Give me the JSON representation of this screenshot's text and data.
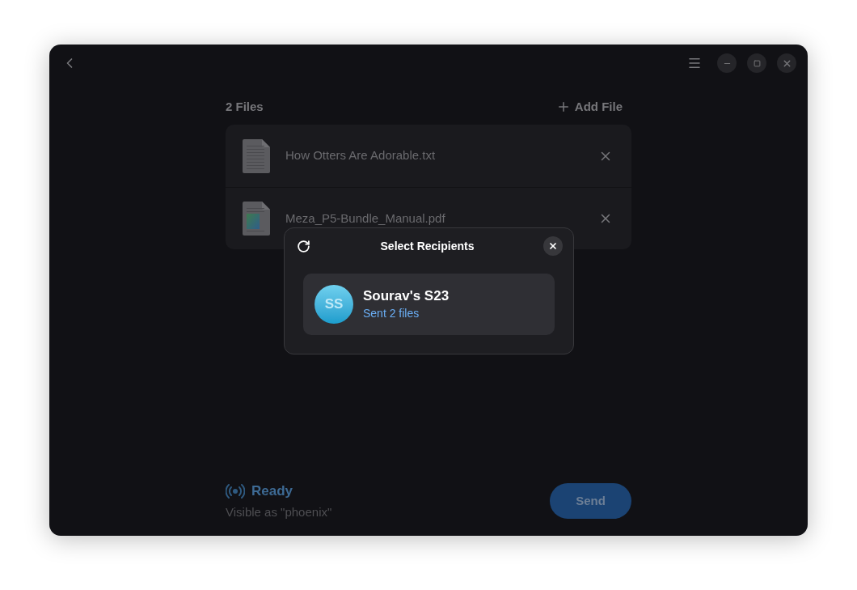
{
  "files_header": {
    "count": "2 Files",
    "add_label": "Add File"
  },
  "files": [
    {
      "name": "How Otters Are Adorable.txt",
      "kind": "text"
    },
    {
      "name": "Meza_P5-Bundle_Manual.pdf",
      "kind": "document"
    }
  ],
  "status": {
    "title": "Ready",
    "subtitle": "Visible as \"phoenix\""
  },
  "send_button": "Send",
  "dialog": {
    "title": "Select Recipients",
    "devices": [
      {
        "initials": "SS",
        "name": "Sourav's S23",
        "status": "Sent 2 files"
      }
    ]
  }
}
